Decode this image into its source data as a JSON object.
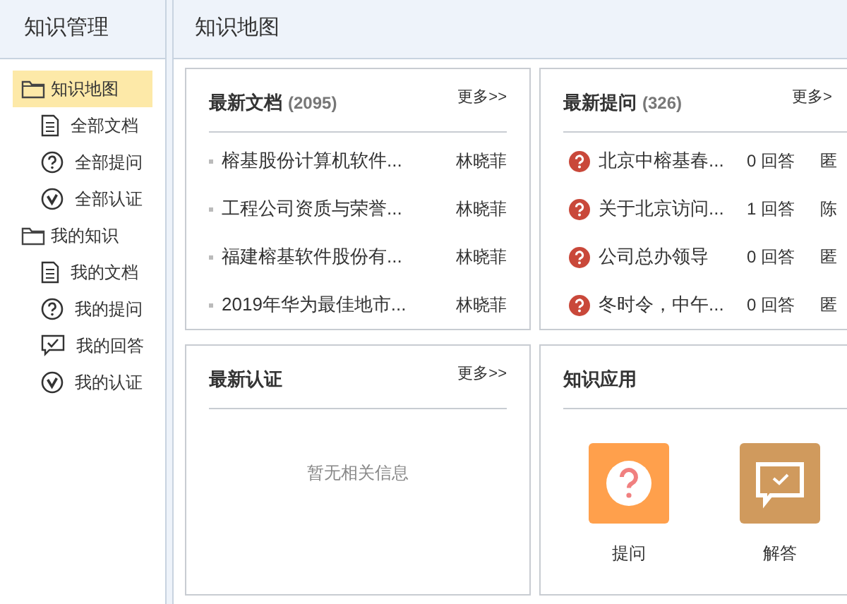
{
  "sidebar": {
    "title": "知识管理",
    "items": [
      {
        "label": "知识地图",
        "kind": "folder",
        "selected": true,
        "children": [
          {
            "label": "全部文档",
            "kind": "document",
            "selected": false
          },
          {
            "label": "全部提问",
            "kind": "question",
            "selected": false
          },
          {
            "label": "全部认证",
            "kind": "verify",
            "selected": false
          }
        ]
      },
      {
        "label": "我的知识",
        "kind": "folder",
        "selected": false,
        "children": [
          {
            "label": "我的文档",
            "kind": "document",
            "selected": false
          },
          {
            "label": "我的提问",
            "kind": "question",
            "selected": false
          },
          {
            "label": "我的回答",
            "kind": "answer",
            "selected": false
          },
          {
            "label": "我的认证",
            "kind": "verify",
            "selected": false
          }
        ]
      }
    ]
  },
  "main": {
    "title": "知识地图",
    "latest_documents": {
      "title": "最新文档",
      "count": "(2095)",
      "more": "更多>>",
      "rows": [
        {
          "title": "榕基股份计算机软件...",
          "author": "林晓菲"
        },
        {
          "title": "工程公司资质与荣誉...",
          "author": "林晓菲"
        },
        {
          "title": "福建榕基软件股份有...",
          "author": "林晓菲"
        },
        {
          "title": "2019年华为最佳地市...",
          "author": "林晓菲"
        }
      ]
    },
    "latest_questions": {
      "title": "最新提问",
      "count": "(326)",
      "more": "更多>",
      "rows": [
        {
          "title": "北京中榕基春...",
          "answers": "0 回答",
          "column_3": "匿"
        },
        {
          "title": "关于北京访问...",
          "answers": "1 回答",
          "column_3": "陈"
        },
        {
          "title": "公司总办领导",
          "answers": "0 回答",
          "column_3": "匿"
        },
        {
          "title": "冬时令，中午...",
          "answers": "0 回答",
          "column_3": "匿"
        }
      ]
    },
    "latest_certifications": {
      "title": "最新认证",
      "more": "更多>>",
      "empty": "暂无相关信息"
    },
    "knowledge_apps": {
      "title": "知识应用",
      "apps": [
        {
          "label": "提问",
          "kind": "ask"
        },
        {
          "label": "解答",
          "kind": "answer"
        }
      ]
    }
  }
}
